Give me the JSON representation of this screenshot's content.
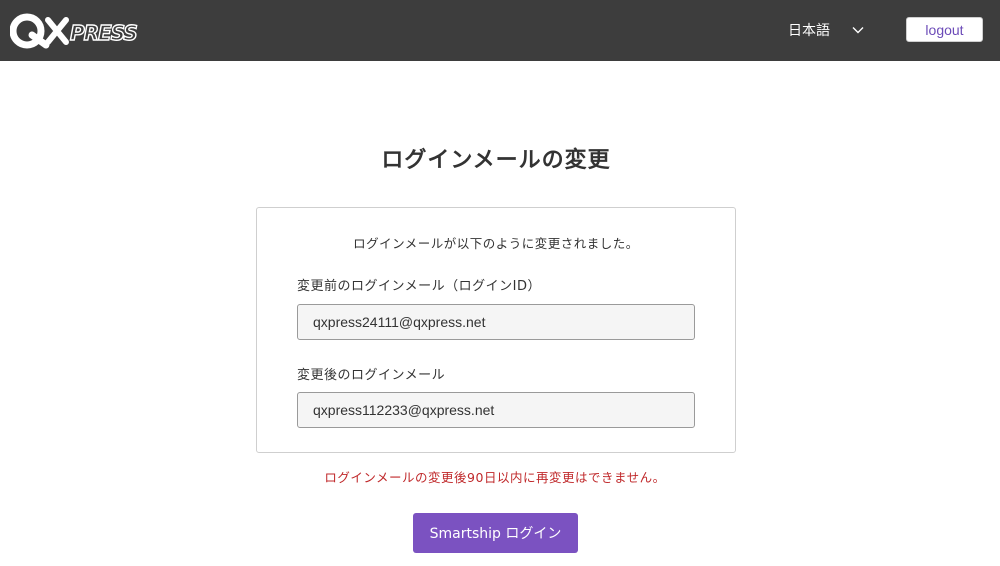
{
  "header": {
    "brand": "QXPRESS",
    "language": "日本語",
    "logout_label": "logout",
    "background": "#3d3d3d"
  },
  "main": {
    "title": "ログインメールの変更",
    "message": "ログインメールが以下のように変更されました。",
    "fields": [
      {
        "label": "変更前のログインメール（ログインID）",
        "value": "qxpress24111@qxpress.net"
      },
      {
        "label": "変更後のログインメール",
        "value": "qxpress112233@qxpress.net"
      }
    ],
    "warning": "ログインメールの変更後90日以内に再変更はできません。",
    "primary_button_label": "Smartship ログイン"
  },
  "colors": {
    "accent": "#7b52c1",
    "warning": "#c0292b"
  },
  "icons": {
    "language_dropdown": "chevron-down-icon"
  }
}
